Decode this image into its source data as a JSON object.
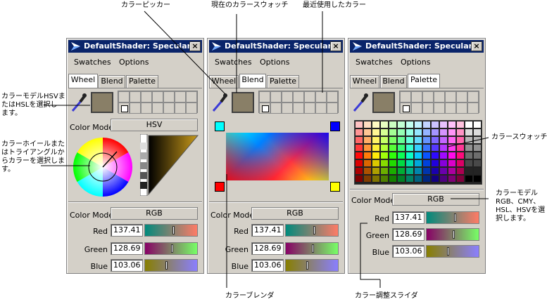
{
  "panels": [
    {
      "title": "DefaultShader: Specular",
      "close": "×",
      "menu": [
        "Swatches",
        "Options"
      ],
      "tabs": [
        "Wheel",
        "Blend",
        "Palette"
      ],
      "active_tab": "Wheel",
      "top_model_label": "Color Model",
      "top_model_value": "HSV",
      "model_label": "Color Model",
      "model_value": "RGB",
      "sliders": [
        {
          "label": "Red",
          "value": "137.41"
        },
        {
          "label": "Green",
          "value": "128.69"
        },
        {
          "label": "Blue",
          "value": "103.06"
        }
      ]
    },
    {
      "title": "DefaultShader: Specular",
      "close": "×",
      "menu": [
        "Swatches",
        "Options"
      ],
      "tabs": [
        "Wheel",
        "Blend",
        "Palette"
      ],
      "active_tab": "Blend",
      "model_label": "Color Model",
      "model_value": "RGB",
      "sliders": [
        {
          "label": "Red",
          "value": "137.41"
        },
        {
          "label": "Green",
          "value": "128.69"
        },
        {
          "label": "Blue",
          "value": "103.06"
        }
      ]
    },
    {
      "title": "DefaultShader: Specular",
      "close": "×",
      "menu": [
        "Swatches",
        "Options"
      ],
      "tabs": [
        "Wheel",
        "Blend",
        "Palette"
      ],
      "active_tab": "Palette",
      "model_label": "Color Model",
      "model_value": "RGB",
      "sliders": [
        {
          "label": "Red",
          "value": "137.41"
        },
        {
          "label": "Green",
          "value": "128.69"
        },
        {
          "label": "Blue",
          "value": "103.06"
        }
      ]
    }
  ],
  "callouts": {
    "picker": "カラーピッカー",
    "current_swatch": "現在のカラースウォッチ",
    "recent": "最近使用したカラー",
    "hsv_select_1": "カラーモデルHSVま",
    "hsv_select_2": "たはHSLを選択し",
    "hsv_select_3": "ます。",
    "wheel_1": "カラーホイールまた",
    "wheel_2": "はトライアングルか",
    "wheel_3": "らカラーを選択しま",
    "wheel_4": "す。",
    "swatch": "カラースウォッチ",
    "model_1": "カラーモデル",
    "model_2": "RGB、CMY、",
    "model_3": "HSL、HSVを選",
    "model_4": "択します。",
    "blender": "カラーブレンダ",
    "sliders": "カラー調整スライダ"
  },
  "colors": {
    "current": "#897f67",
    "titlebar": "#0a246a",
    "blend_tl": "#00ffff",
    "blend_tr": "#0000ff",
    "blend_bl": "#ff0000",
    "blend_br": "#ffff00"
  }
}
